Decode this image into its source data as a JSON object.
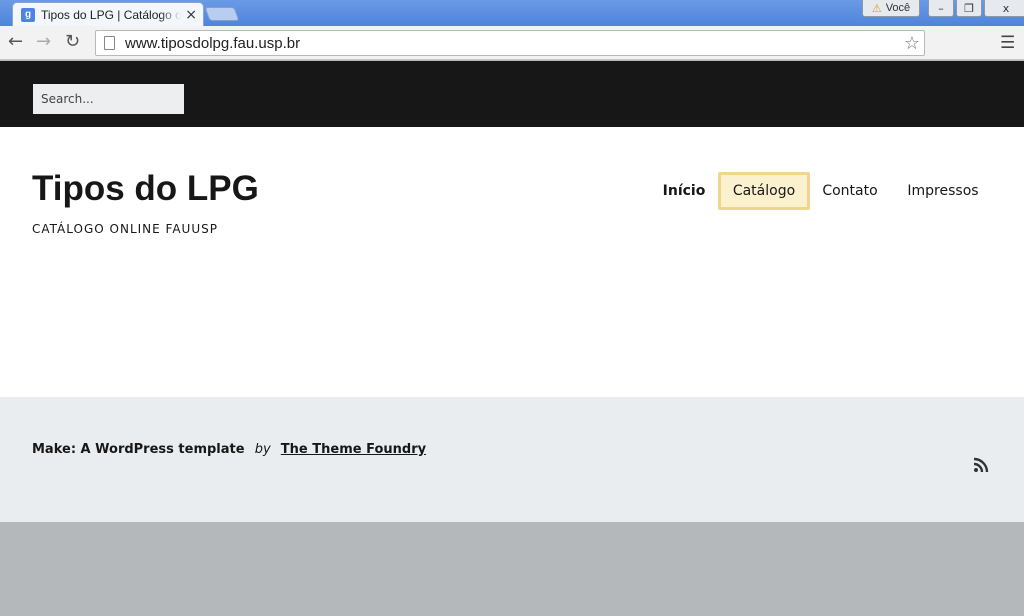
{
  "browser": {
    "tab_title": "Tipos do LPG | Catálogo o",
    "tab_favicon_letter": "g",
    "profile_label": "Você",
    "url": "www.tiposdolpg.fau.usp.br"
  },
  "site": {
    "search_placeholder": "Search...",
    "title": "Tipos do LPG",
    "description": "CATÁLOGO ONLINE FAUUSP",
    "nav": {
      "home": "Início",
      "catalog": "Catálogo",
      "contact": "Contato",
      "prints": "Impressos"
    },
    "footer": {
      "theme_name": "Make: A WordPress template",
      "by": "by",
      "author_link": "The Theme Foundry",
      "rss_icon": "rss-icon"
    }
  },
  "colors": {
    "topbar": "#171717",
    "footer_bg": "#eaedef",
    "nav_highlight_bg": "#fbf1cf",
    "nav_highlight_border": "#f0d68a"
  }
}
